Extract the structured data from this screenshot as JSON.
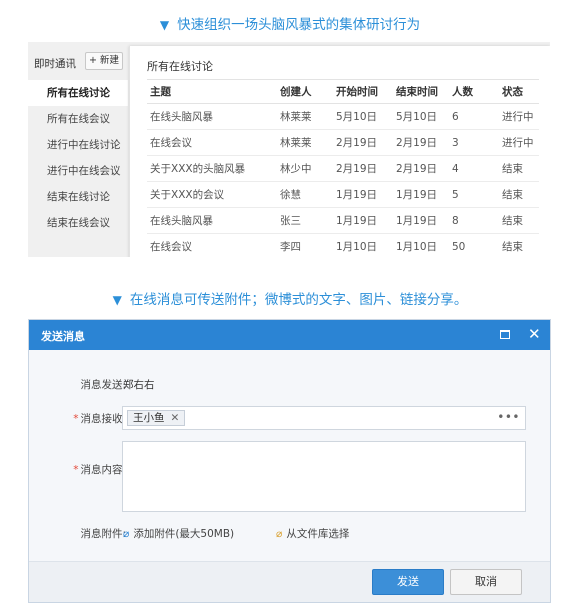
{
  "captions": {
    "top": "快速组织一场头脑风暴式的集体研讨行为",
    "bottom": "在线消息可传送附件；微博式的文字、图片、链接分享。",
    "marker": "▼"
  },
  "discussions": {
    "top_label": "即时通讯",
    "new_button": "新建",
    "nav": [
      "所有在线讨论",
      "所有在线会议",
      "进行中在线讨论",
      "进行中在线会议",
      "结束在线讨论",
      "结束在线会议"
    ],
    "panel_title": "所有在线讨论",
    "columns": [
      "主题",
      "创建人",
      "开始时间",
      "结束时间",
      "人数",
      "状态"
    ],
    "rows": [
      [
        "在线头脑风暴",
        "林莱莱",
        "5月10日",
        "5月10日",
        "6",
        "进行中"
      ],
      [
        "在线会议",
        "林莱莱",
        "2月19日",
        "2月19日",
        "3",
        "进行中"
      ],
      [
        "关于XXX的头脑风暴",
        "林少中",
        "2月19日",
        "2月19日",
        "4",
        "结束"
      ],
      [
        "关于XXX的会议",
        "徐慧",
        "1月19日",
        "1月19日",
        "5",
        "结束"
      ],
      [
        "在线头脑风暴",
        "张三",
        "1月19日",
        "1月19日",
        "8",
        "结束"
      ],
      [
        "在线会议",
        "李四",
        "1月10日",
        "1月10日",
        "50",
        "结束"
      ]
    ]
  },
  "dialog": {
    "title": "发送消息",
    "sender_label": "消息发送:",
    "sender_value": "郑右右",
    "receiver_label": "消息接收:",
    "receiver_tag": "王小鱼",
    "content_label": "消息内容:",
    "attach_label": "消息附件:",
    "attach_add": "添加附件(最大50MB)",
    "attach_lib": "从文件库选择",
    "send": "发送",
    "cancel": "取消"
  }
}
